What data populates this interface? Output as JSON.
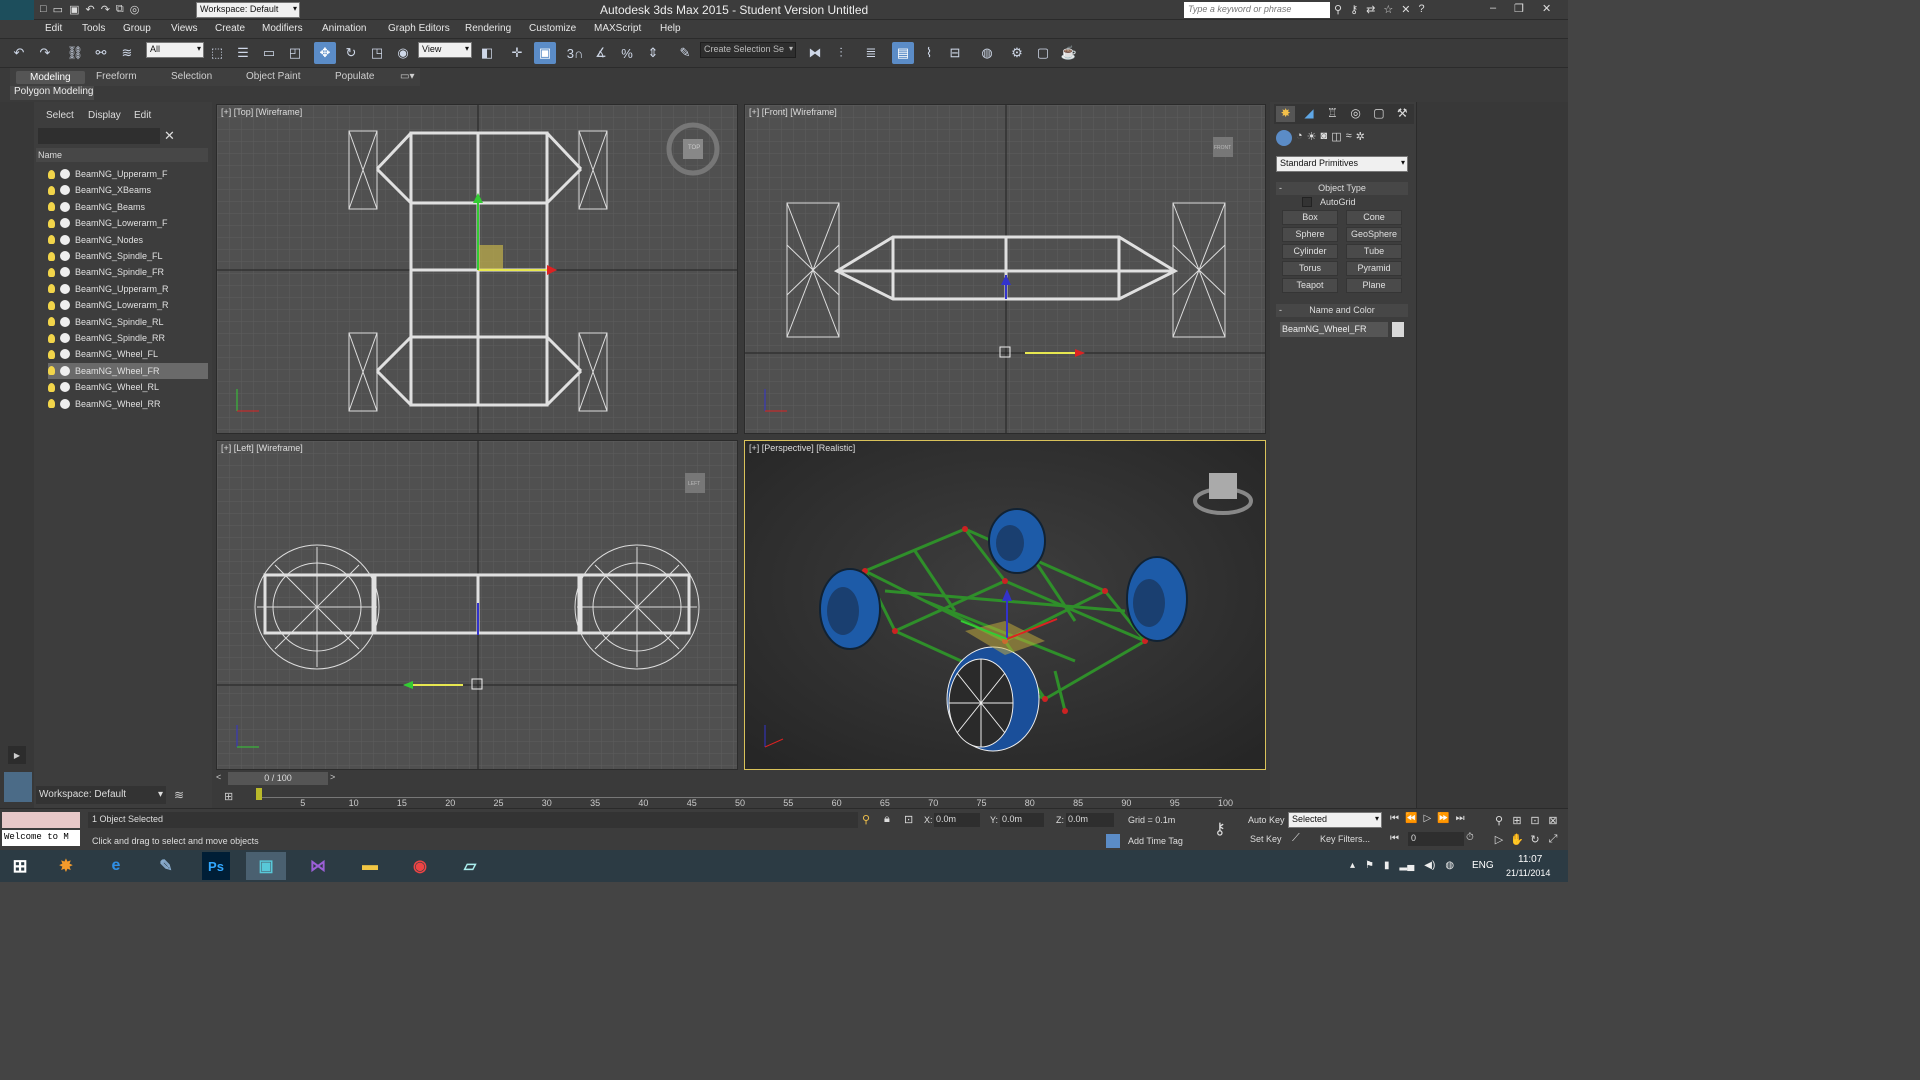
{
  "titlebar": {
    "app_logo": "MAX",
    "workspace": "Workspace: Default",
    "title": "Autodesk 3ds Max  2015   - Student Version    Untitled",
    "search_placeholder": "Type a keyword or phrase",
    "minimize": "–",
    "restore": "❐",
    "close": "✕"
  },
  "menubar": [
    "Edit",
    "Tools",
    "Group",
    "Views",
    "Create",
    "Modifiers",
    "Animation",
    "Graph Editors",
    "Rendering",
    "Customize",
    "MAXScript",
    "Help"
  ],
  "toolbar": {
    "filter": "All",
    "refcoord": "View",
    "selection_set": "Create Selection Se",
    "snap_3": "3",
    "percent": "%"
  },
  "ribbon": {
    "tabs": [
      "Modeling",
      "Freeform",
      "Selection",
      "Object Paint",
      "Populate"
    ],
    "active_panel": "Polygon Modeling"
  },
  "scene": {
    "tabs": [
      "Select",
      "Display",
      "Edit"
    ],
    "column": "Name",
    "items": [
      {
        "name": "BeamNG_Upperarm_F",
        "selected": false
      },
      {
        "name": "BeamNG_XBeams",
        "selected": false
      },
      {
        "name": "BeamNG_Beams",
        "selected": false
      },
      {
        "name": "BeamNG_Lowerarm_F",
        "selected": false
      },
      {
        "name": "BeamNG_Nodes",
        "selected": false
      },
      {
        "name": "BeamNG_Spindle_FL",
        "selected": false
      },
      {
        "name": "BeamNG_Spindle_FR",
        "selected": false
      },
      {
        "name": "BeamNG_Upperarm_R",
        "selected": false
      },
      {
        "name": "BeamNG_Lowerarm_R",
        "selected": false
      },
      {
        "name": "BeamNG_Spindle_RL",
        "selected": false
      },
      {
        "name": "BeamNG_Spindle_RR",
        "selected": false
      },
      {
        "name": "BeamNG_Wheel_FL",
        "selected": false
      },
      {
        "name": "BeamNG_Wheel_FR",
        "selected": true
      },
      {
        "name": "BeamNG_Wheel_RL",
        "selected": false
      },
      {
        "name": "BeamNG_Wheel_RR",
        "selected": false
      }
    ],
    "workspace": "Workspace: Default"
  },
  "viewports": {
    "top": "[+] [Top] [Wireframe]",
    "front": "[+] [Front] [Wireframe]",
    "left": "[+] [Left] [Wireframe]",
    "perspective": "[+] [Perspective] [Realistic]",
    "cube_top": "TOP",
    "cube_front": "FRONT",
    "cube_left": "LEFT"
  },
  "command_panel": {
    "category": "Standard Primitives",
    "object_type_header": "Object Type",
    "autogrid": "AutoGrid",
    "buttons": [
      "Box",
      "Cone",
      "Sphere",
      "GeoSphere",
      "Cylinder",
      "Tube",
      "Torus",
      "Pyramid",
      "Teapot",
      "Plane"
    ],
    "name_color_header": "Name and Color",
    "object_name": "BeamNG_Wheel_FR",
    "object_color": "#d8d8d8"
  },
  "timeline": {
    "frame_counter": "0 / 100",
    "ticks": [
      "5",
      "10",
      "15",
      "20",
      "25",
      "30",
      "35",
      "40",
      "45",
      "50",
      "55",
      "60",
      "65",
      "70",
      "75",
      "80",
      "85",
      "90",
      "95",
      "100"
    ],
    "current_frame": 0
  },
  "status": {
    "listener": "Welcome to M",
    "selection": "1 Object Selected",
    "prompt": "Click and drag to select and move objects",
    "x_label": "X:",
    "x": "0.0m",
    "y_label": "Y:",
    "y": "0.0m",
    "z_label": "Z:",
    "z": "0.0m",
    "grid": "Grid = 0.1m",
    "add_time_tag": "Add Time Tag",
    "auto_key": "Auto Key",
    "set_key": "Set Key",
    "selected": "Selected",
    "key_filters": "Key Filters...",
    "frame": "0"
  },
  "taskbar": {
    "lang": "ENG",
    "time": "11:07",
    "date": "21/11/2014"
  }
}
